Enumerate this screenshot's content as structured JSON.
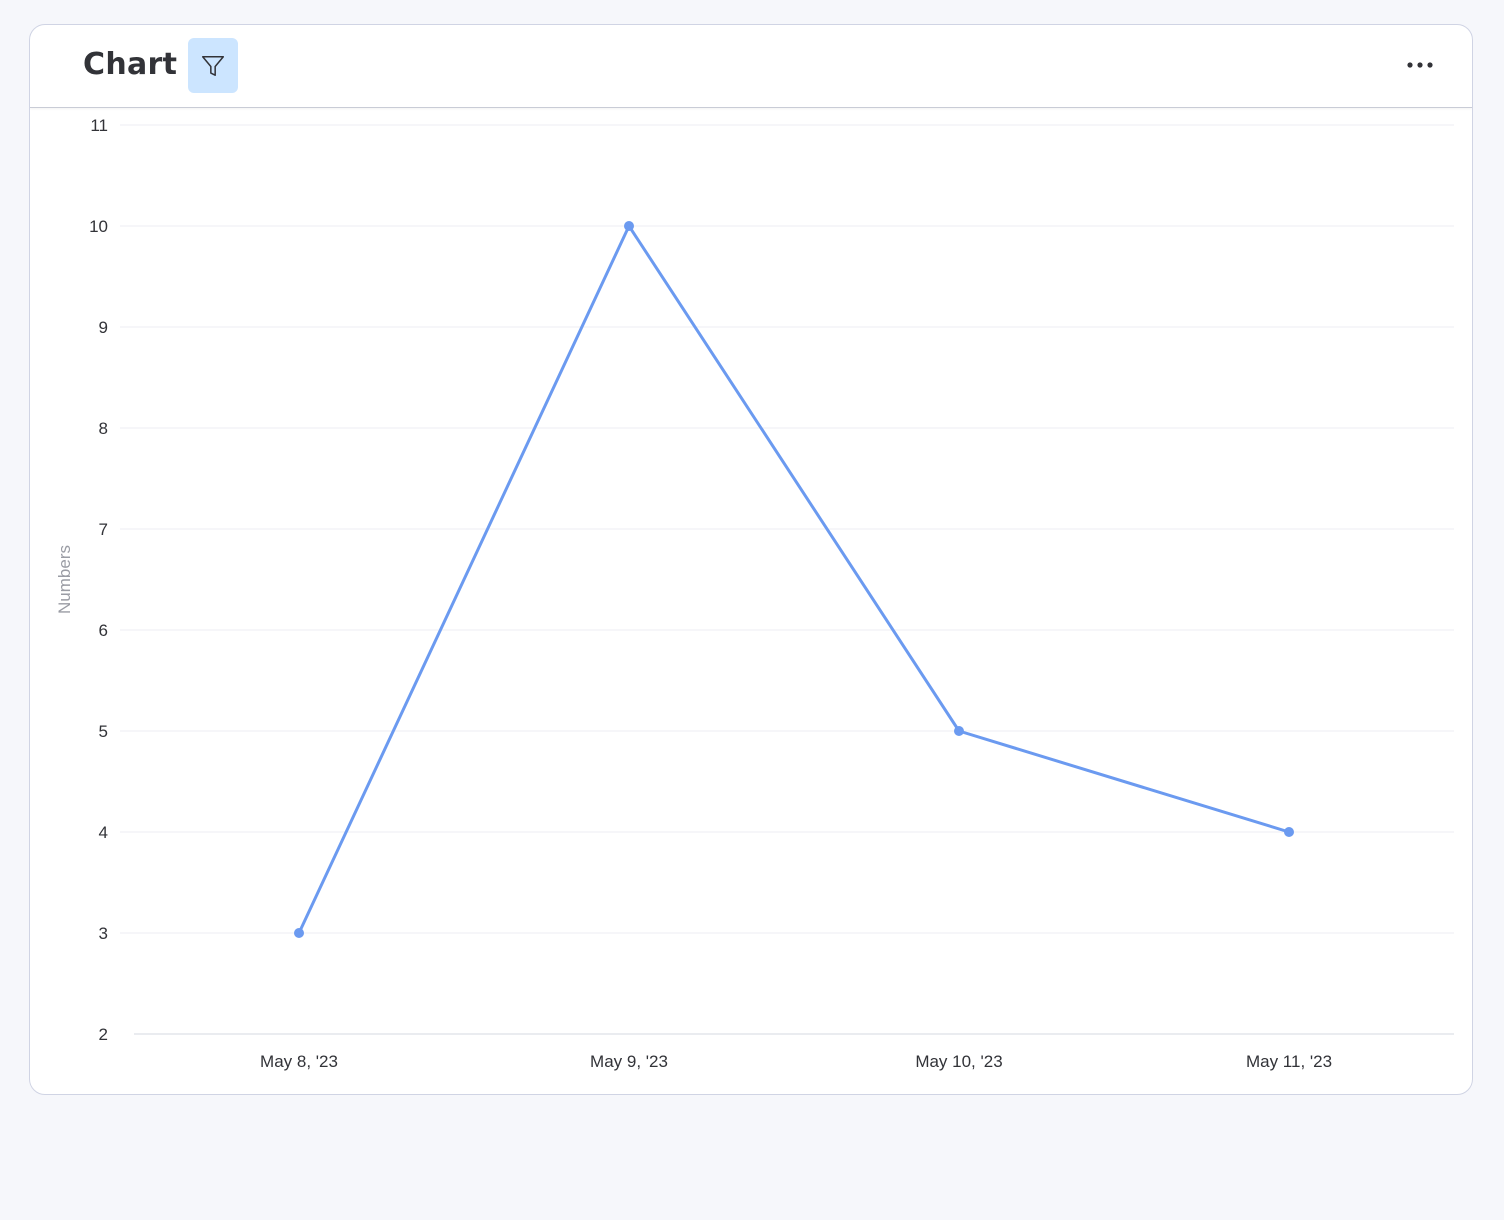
{
  "widget": {
    "title": "Chart",
    "filter_icon": "filter-icon",
    "more_icon": "more-horizontal-icon"
  },
  "colors": {
    "line": "#6b9af0",
    "grid": "#eceef3",
    "filter_bg": "#cce5ff"
  },
  "chart_data": {
    "type": "line",
    "categories": [
      "May 8, '23",
      "May 9, '23",
      "May 10, '23",
      "May 11, '23"
    ],
    "series": [
      {
        "values": [
          3,
          10,
          5,
          4
        ]
      }
    ],
    "ylabel": "Numbers",
    "xlabel": "",
    "ylim": [
      2,
      11
    ],
    "yticks": [
      "2",
      "3",
      "4",
      "5",
      "6",
      "7",
      "8",
      "9",
      "10",
      "11"
    ],
    "grid": true,
    "legend": "none"
  }
}
